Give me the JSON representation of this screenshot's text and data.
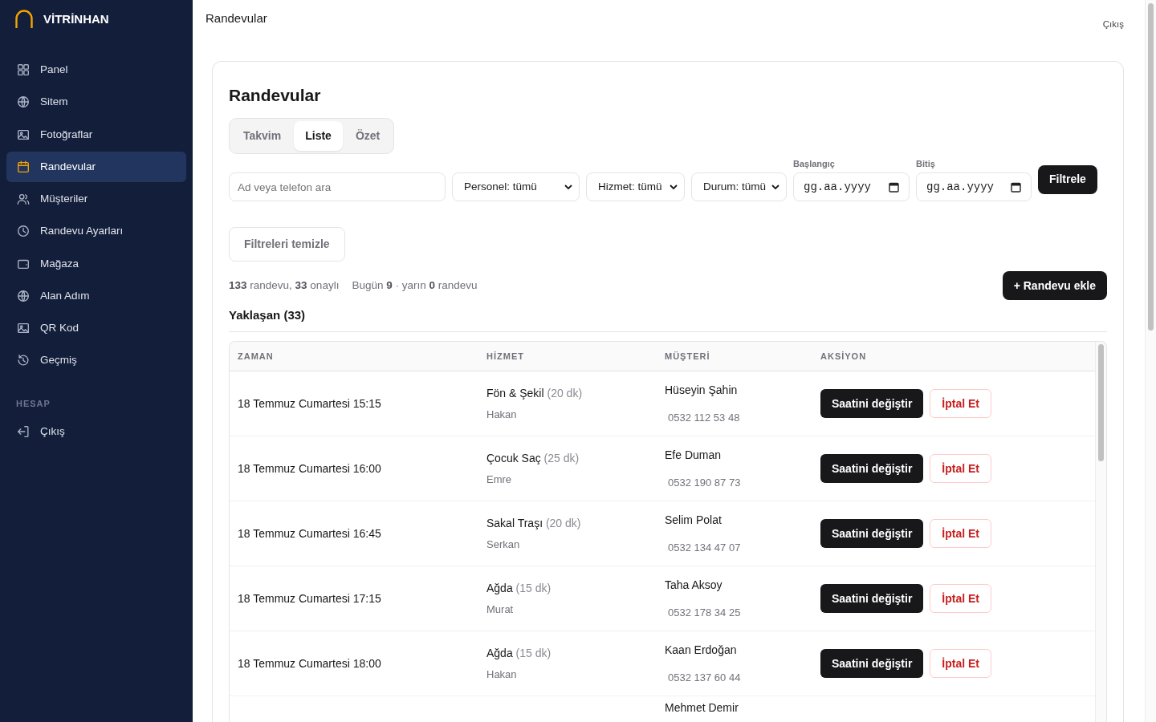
{
  "brand": {
    "name": "VİTRİNHAN"
  },
  "sidebar": {
    "items": [
      {
        "label": "Panel",
        "selected": false
      },
      {
        "label": "Sitem",
        "selected": false
      },
      {
        "label": "Fotoğraflar",
        "selected": false
      },
      {
        "label": "Randevular",
        "selected": true
      },
      {
        "label": "Müşteriler",
        "selected": false
      },
      {
        "label": "Randevu Ayarları",
        "selected": false
      },
      {
        "label": "Mağaza",
        "selected": false
      },
      {
        "label": "Alan Adım",
        "selected": false
      },
      {
        "label": "QR Kod",
        "selected": false
      },
      {
        "label": "Geçmiş",
        "selected": false
      }
    ],
    "section": "HESAP",
    "account_items": [
      {
        "label": "Çıkış"
      }
    ]
  },
  "header": {
    "title": "Randevular",
    "logout": "Çıkış"
  },
  "card": {
    "title": "Randevular",
    "tabs": [
      {
        "label": "Takvim",
        "selected": false
      },
      {
        "label": "Liste",
        "selected": true
      },
      {
        "label": "Özet",
        "selected": false
      }
    ],
    "search": {
      "placeholder": "Ad veya telefon ara"
    },
    "selects": [
      "Personel: tümü",
      "Hizmet: tümü",
      "Durum: tümü"
    ],
    "dates": [
      {
        "label": "Başlangıç",
        "placeholder": "gg.aa.yyyy"
      },
      {
        "label": "Bitiş",
        "placeholder": "gg.aa.yyyy"
      }
    ],
    "filter_button": "Filtrele",
    "clear_button": "Filtreleri temizle",
    "summary": [
      "**133** randevu, **33** onaylı",
      "Bugün **9** · yarın **0** randevu"
    ],
    "add_button": "+ Randevu ekle",
    "section_title": "Yaklaşan (33)",
    "table": {
      "columns": [
        "ZAMAN",
        "HİZMET",
        "MÜŞTERİ",
        "AKSİYON"
      ],
      "rows": [
        {
          "time": "18 Temmuz Cumartesi 15:15",
          "service": "Fön & Şekil",
          "duration": "(20 dk)",
          "staff": "Hakan",
          "customer": "Hüseyin Şahin",
          "phone": "0532 112 53 48",
          "actions": [
            "Saatini değiştir",
            "İptal Et"
          ]
        },
        {
          "time": "18 Temmuz Cumartesi 16:00",
          "service": "Çocuk Saç",
          "duration": "(25 dk)",
          "staff": "Emre",
          "customer": "Efe Duman",
          "phone": "0532 190 87 73",
          "actions": [
            "Saatini değiştir",
            "İptal Et"
          ]
        },
        {
          "time": "18 Temmuz Cumartesi 16:45",
          "service": "Sakal Traşı",
          "duration": "(20 dk)",
          "staff": "Serkan",
          "customer": "Selim Polat",
          "phone": "0532 134 47 07",
          "actions": [
            "Saatini değiştir",
            "İptal Et"
          ]
        },
        {
          "time": "18 Temmuz Cumartesi 17:15",
          "service": "Ağda",
          "duration": "(15 dk)",
          "staff": "Murat",
          "customer": "Taha Aksoy",
          "phone": "0532 178 34 25",
          "actions": [
            "Saatini değiştir",
            "İptal Et"
          ]
        },
        {
          "time": "18 Temmuz Cumartesi 18:00",
          "service": "Ağda",
          "duration": "(15 dk)",
          "staff": "Hakan",
          "customer": "Kaan Erdoğan",
          "phone": "0532 137 60 44",
          "actions": [
            "Saatini değiştir",
            "İptal Et"
          ]
        },
        {
          "customer": "Mehmet Demir"
        }
      ]
    }
  }
}
